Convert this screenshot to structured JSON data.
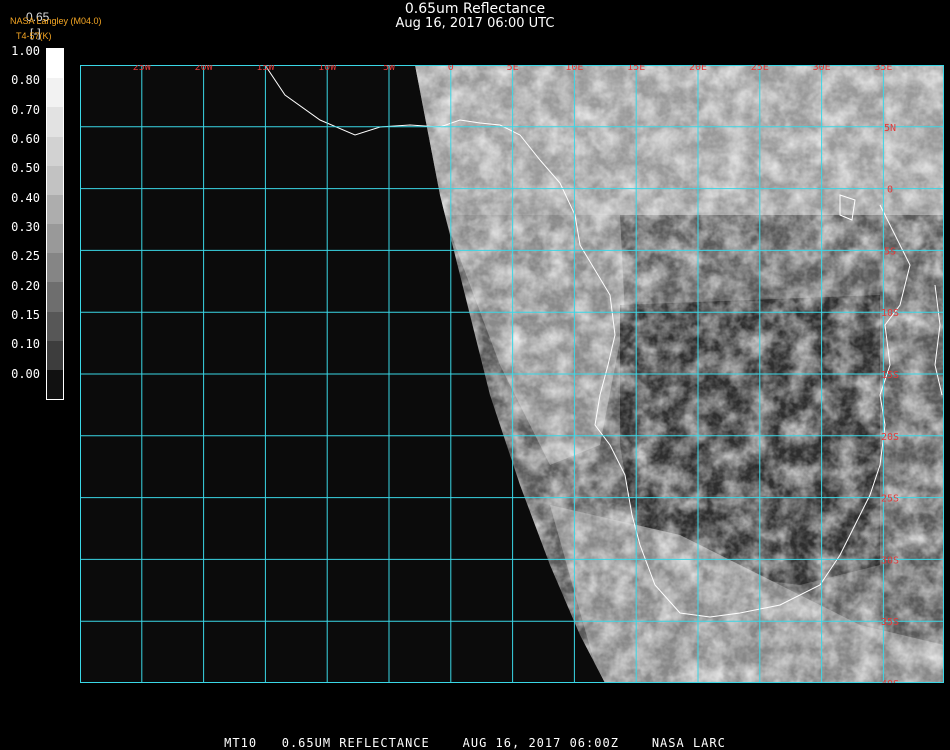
{
  "title": {
    "line1": "0.65um Reflectance",
    "line2": "Aug 16, 2017 06:00 UTC"
  },
  "credit": {
    "org": "NASA Langley (M04.0)",
    "sub": "T4-57(K)"
  },
  "colorbar": {
    "label_top": "0.65",
    "label_sub": "[-]",
    "ticks": [
      "1.00",
      "0.80",
      "0.70",
      "0.60",
      "0.50",
      "0.40",
      "0.30",
      "0.25",
      "0.20",
      "0.15",
      "0.10",
      "0.00"
    ],
    "grays": [
      "#ffffff",
      "#f2f2f2",
      "#e2e2e2",
      "#d2d2d2",
      "#c2c2c2",
      "#adadad",
      "#999999",
      "#858585",
      "#6e6e6e",
      "#575757",
      "#3d3d3d",
      "#111111"
    ]
  },
  "map": {
    "lon_labels": [
      "25W",
      "20W",
      "15W",
      "10W",
      "5W",
      "0",
      "5E",
      "10E",
      "15E",
      "20E",
      "25E",
      "30E",
      "35E"
    ],
    "lat_labels": [
      "5N",
      "0",
      "5S",
      "10S",
      "15S",
      "20S",
      "25S",
      "30S",
      "35S",
      "40S"
    ],
    "grid_color": "#3ad7e6",
    "label_color": "#e23a3a",
    "coast_color": "#ffffff"
  },
  "footer": "MT10   0.65UM REFLECTANCE    AUG 16, 2017 06:00Z    NASA LARC"
}
